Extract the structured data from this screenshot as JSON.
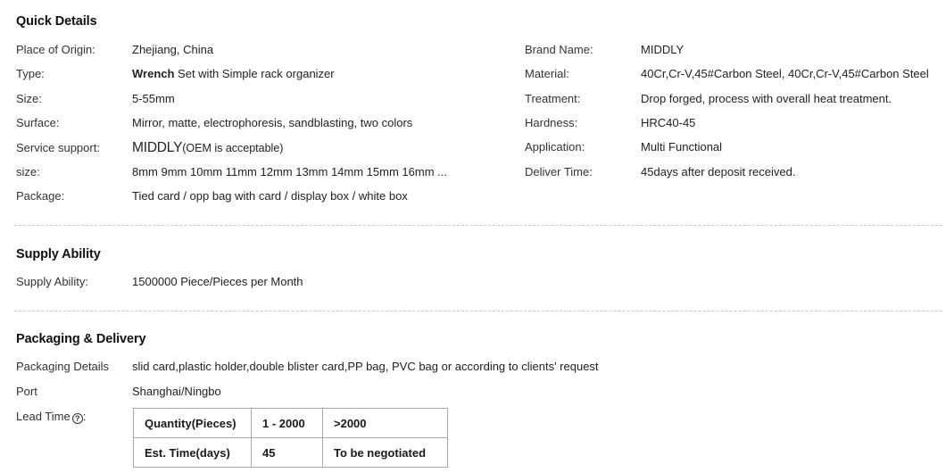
{
  "quick_details": {
    "heading": "Quick Details",
    "left_rows": [
      {
        "label": "Place of Origin:",
        "value": "Zhejiang, China"
      },
      {
        "label": "Type:",
        "value_bold": "Wrench",
        "value_rest": " Set with Simple rack organizer"
      },
      {
        "label": "Size:",
        "value": "5-55mm"
      },
      {
        "label": "Surface:",
        "value": "Mirror, matte, electrophoresis, sandblasting, two colors"
      },
      {
        "label": "Service support:",
        "value_big": "MIDDLY",
        "value_rest": "(OEM is acceptable)"
      },
      {
        "label": "size:",
        "value": "8mm 9mm 10mm 11mm 12mm 13mm 14mm 15mm 16mm ..."
      },
      {
        "label": "Package:",
        "value": "Tied card / opp bag with card / display box / white box"
      }
    ],
    "right_rows": [
      {
        "label": "Brand Name:",
        "value": "MIDDLY"
      },
      {
        "label": "Material:",
        "value": "40Cr,Cr-V,45#Carbon Steel, 40Cr,Cr-V,45#Carbon Steel"
      },
      {
        "label": "Treatment:",
        "value": "Drop forged, process with overall heat treatment."
      },
      {
        "label": "Hardness:",
        "value": "HRC40-45"
      },
      {
        "label": "Application:",
        "value": "Multi Functional"
      },
      {
        "label": "Deliver Time:",
        "value": "45days after deposit received."
      }
    ]
  },
  "supply_ability": {
    "heading": "Supply Ability",
    "rows": [
      {
        "label": "Supply Ability:",
        "value": "1500000 Piece/Pieces per Month"
      }
    ]
  },
  "packaging_delivery": {
    "heading": "Packaging & Delivery",
    "rows": [
      {
        "label": "Packaging Details",
        "value": "slid card,plastic holder,double blister card,PP bag, PVC bag or according to clients' request"
      },
      {
        "label": "Port",
        "value": "Shanghai/Ningbo"
      }
    ],
    "lead_time": {
      "label": "Lead Time",
      "help_icon": "help-circle-icon",
      "help_glyph": "?",
      "colon": ":",
      "table": {
        "rows": [
          [
            "Quantity(Pieces)",
            "1 - 2000",
            ">2000"
          ],
          [
            "Est. Time(days)",
            "45",
            "To be negotiated"
          ]
        ]
      }
    }
  },
  "colors": {
    "text": "#222222",
    "heading": "#111111",
    "separator": "#c9c9c9",
    "table_border": "#a9a9a9",
    "background": "#ffffff"
  }
}
